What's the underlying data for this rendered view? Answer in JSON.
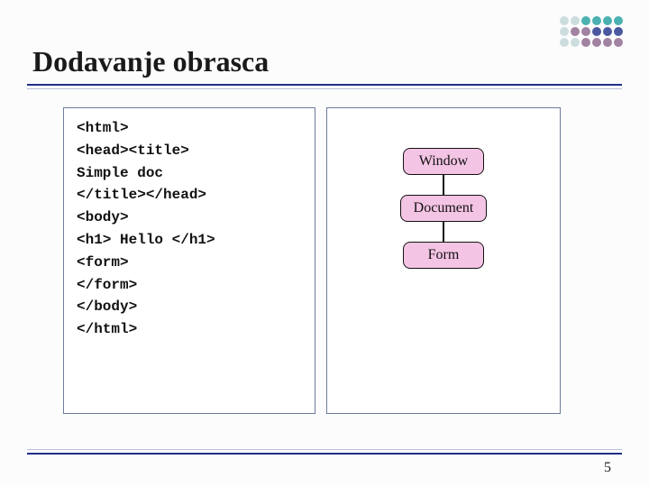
{
  "title": "Dodavanje obrasca",
  "code_lines": [
    "<html>",
    "<head><title>",
    "Simple doc",
    "</title></head>",
    "<body>",
    "<h1> Hello </h1>",
    "<form>",
    "</form>",
    "</body>",
    "</html>"
  ],
  "tree": {
    "nodes": [
      "Window",
      "Document",
      "Form"
    ]
  },
  "page_number": "5"
}
